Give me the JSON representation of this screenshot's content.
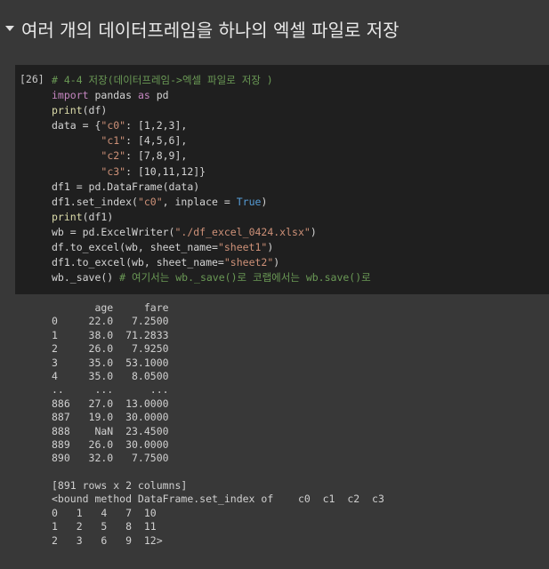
{
  "section": {
    "title": "여러 개의 데이터프레임을 하나의 엑셀 파일로 저장",
    "toggle_icon": "caret-down-icon"
  },
  "cell": {
    "execution_count": "[26]",
    "code_lines": [
      [
        {
          "t": "# 4-4 저장(데이터프레임->엑셀 파일로 저장 )",
          "c": "comment"
        }
      ],
      [
        {
          "t": "import",
          "c": "keyword"
        },
        {
          "t": " pandas ",
          "c": "default"
        },
        {
          "t": "as",
          "c": "keyword"
        },
        {
          "t": " pd",
          "c": "default"
        }
      ],
      [
        {
          "t": "print",
          "c": "func"
        },
        {
          "t": "(df)",
          "c": "default"
        }
      ],
      [
        {
          "t": "data = {",
          "c": "default"
        },
        {
          "t": "\"c0\"",
          "c": "string"
        },
        {
          "t": ": [1,2,3],",
          "c": "default"
        }
      ],
      [
        {
          "t": "        ",
          "c": "default"
        },
        {
          "t": "\"c1\"",
          "c": "string"
        },
        {
          "t": ": [4,5,6],",
          "c": "default"
        }
      ],
      [
        {
          "t": "        ",
          "c": "default"
        },
        {
          "t": "\"c2\"",
          "c": "string"
        },
        {
          "t": ": [7,8,9],",
          "c": "default"
        }
      ],
      [
        {
          "t": "        ",
          "c": "default"
        },
        {
          "t": "\"c3\"",
          "c": "string"
        },
        {
          "t": ": [10,11,12]}",
          "c": "default"
        }
      ],
      [
        {
          "t": "df1 = pd.DataFrame(data)",
          "c": "default"
        }
      ],
      [
        {
          "t": "df1.set_index(",
          "c": "default"
        },
        {
          "t": "\"c0\"",
          "c": "string"
        },
        {
          "t": ", inplace = ",
          "c": "default"
        },
        {
          "t": "True",
          "c": "bool"
        },
        {
          "t": ")",
          "c": "default"
        }
      ],
      [
        {
          "t": "print",
          "c": "func"
        },
        {
          "t": "(df1)",
          "c": "default"
        }
      ],
      [
        {
          "t": "wb = pd.ExcelWriter(",
          "c": "default"
        },
        {
          "t": "\"./df_excel_0424.xlsx\"",
          "c": "string"
        },
        {
          "t": ")",
          "c": "default"
        }
      ],
      [
        {
          "t": "df.to_excel(wb, sheet_name=",
          "c": "default"
        },
        {
          "t": "\"sheet1\"",
          "c": "string"
        },
        {
          "t": ")",
          "c": "default"
        }
      ],
      [
        {
          "t": "df1.to_excel(wb, sheet_name=",
          "c": "default"
        },
        {
          "t": "\"sheet2\"",
          "c": "string"
        },
        {
          "t": ")",
          "c": "default"
        }
      ],
      [
        {
          "t": "wb._save() ",
          "c": "default"
        },
        {
          "t": "# 여기서는 wb._save()로 코랩에서는 wb.save()로",
          "c": "comment"
        }
      ]
    ]
  },
  "output_lines": [
    "       age     fare",
    "0     22.0   7.2500",
    "1     38.0  71.2833",
    "2     26.0   7.9250",
    "3     35.0  53.1000",
    "4     35.0   8.0500",
    "..     ...      ...",
    "886   27.0  13.0000",
    "887   19.0  30.0000",
    "888    NaN  23.4500",
    "889   26.0  30.0000",
    "890   32.0   7.7500",
    "",
    "[891 rows x 2 columns]",
    "<bound method DataFrame.set_index of    c0  c1  c2  c3",
    "0   1   4   7  10",
    "1   2   5   8  11",
    "2   3   6   9  12>"
  ],
  "colors": {
    "background": "#383838",
    "cell_background": "#1f1f1f",
    "comment": "#6a9955",
    "keyword": "#c586c0",
    "function": "#dcdcaa",
    "string": "#ce9178",
    "boolean": "#569cd6"
  }
}
